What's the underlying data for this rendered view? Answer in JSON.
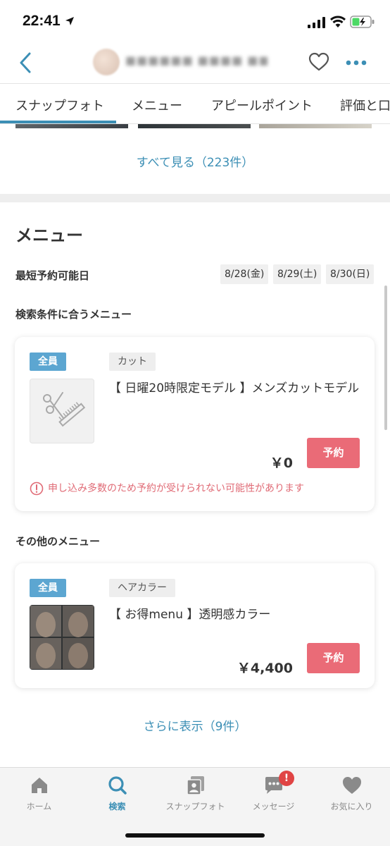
{
  "status_bar": {
    "time": "22:41"
  },
  "header": {
    "salon_name": "■■■■■■ ■■■■ ■■■■"
  },
  "tabs": [
    {
      "label": "スナップフォト"
    },
    {
      "label": "メニュー"
    },
    {
      "label": "アピールポイント"
    },
    {
      "label": "評価と口"
    }
  ],
  "snap": {
    "see_all_label": "すべて見る（223件）"
  },
  "menu_section": {
    "heading": "メニュー",
    "earliest_label": "最短予約可能日",
    "dates": [
      "8/28(金)",
      "8/29(土)",
      "8/30(日)"
    ],
    "matching_heading": "検索条件に合うメニュー",
    "other_heading": "その他のメニュー"
  },
  "menu_items": [
    {
      "audience": "全員",
      "category": "カット",
      "title": "【 日曜20時限定モデル 】メンズカットモデル",
      "price": "￥0",
      "reserve_label": "予約",
      "warning": "申し込み多数のため予約が受けられない可能性があります"
    },
    {
      "audience": "全員",
      "category": "ヘアカラー",
      "title": "【 お得menu 】透明感カラー",
      "price": "￥4,400",
      "reserve_label": "予約"
    }
  ],
  "more_label": "さらに表示（9件）",
  "bottom_nav": {
    "items": [
      {
        "label": "ホーム",
        "icon": "home-icon"
      },
      {
        "label": "検索",
        "icon": "search-icon"
      },
      {
        "label": "スナップフォト",
        "icon": "snap-photo-icon"
      },
      {
        "label": "メッセージ",
        "icon": "message-icon"
      },
      {
        "label": "お気に入り",
        "icon": "heart-icon"
      }
    ],
    "message_badge": "!"
  },
  "colors": {
    "accent": "#3c8fb5",
    "reserve": "#ea6b77",
    "badge": "#5ca6d1",
    "warning": "#e06b76"
  }
}
